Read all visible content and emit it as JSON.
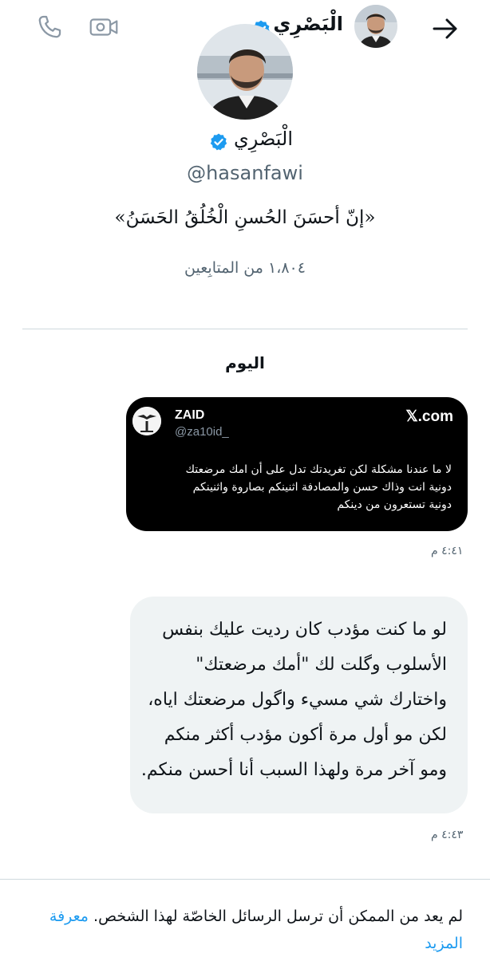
{
  "header": {
    "name": "الْبَصْرِي",
    "icons": {
      "back": "arrow-right-icon",
      "video": "video-camera-icon",
      "call": "phone-icon",
      "verified": "verified-badge-icon"
    }
  },
  "profile": {
    "name": "الْبَصْرِي",
    "handle": "@hasanfawi",
    "bio": "«إنّ أحسَنَ الحُسنِ الْخُلُقُ الحَسَنُ»",
    "followers": "١،٨٠٤ من المتابِعين"
  },
  "conversation": {
    "date_label": "اليوم",
    "shared_post": {
      "author_name": "ZAID",
      "author_handle": "@za10id_",
      "brand": "𝕏.com",
      "text_lines": [
        "لا ما عندنا مشكلة لكن تغريدتك تدل على أن امك مرضعتك",
        "دونية انت وذاك حسن والمصادفة اثنينكم بصاروة واثنينكم",
        "دونية تستعرون من دينكم"
      ],
      "time": "٤:٤١ م"
    },
    "message": {
      "lines": [
        "لو ما كنت مؤدب كان رديت عليك بنفس",
        "الأسلوب وگلت لك \"أمك مرضعتك\"",
        "واختارك شي مسيء واگول مرضعتك اياه،",
        "لكن مو أول مرة أكون مؤدب أكثر منكم",
        "ومو آخر مرة ولهذا السبب أنا أحسن منكم."
      ],
      "time": "٤:٤٣ م"
    }
  },
  "footer": {
    "notice": "لم يعد من الممكن أن ترسل الرسائل الخاصّة لهذا الشخص.",
    "link": "معرفة المزيد"
  },
  "colors": {
    "accent": "#1d9bf0",
    "text_primary": "#0f1419",
    "text_secondary": "#536471",
    "bubble": "#eff3f4",
    "card": "#000000"
  }
}
